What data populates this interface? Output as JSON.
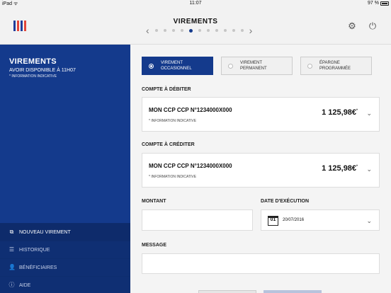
{
  "status": {
    "left": "iPad ᯤ",
    "time": "11:07",
    "battery": "97 %"
  },
  "header": {
    "title": "VIREMENTS"
  },
  "logo_colors": [
    "#1f3d9a",
    "#e2463a",
    "#1f3d9a",
    "#e2463a"
  ],
  "pager": {
    "dots": 11,
    "active_index": 4
  },
  "sidebar": {
    "title": "VIREMENTS",
    "subtitle": "AVOIR DISPONIBLE À 11H07",
    "note": "* INFORMATION INDICATIVE",
    "menu": [
      {
        "label": "NOUVEAU VIREMENT",
        "icon": "new-transfer-icon",
        "glyph": "⧉"
      },
      {
        "label": "HISTORIQUE",
        "icon": "history-list-icon",
        "glyph": "☰"
      },
      {
        "label": "BÉNÉFICIAIRES",
        "icon": "beneficiaries-icon",
        "glyph": "👤"
      },
      {
        "label": "AIDE",
        "icon": "help-icon",
        "glyph": "ⓘ"
      }
    ]
  },
  "segments": [
    {
      "label": "VIREMENT OCCASIONNEL",
      "line1": "VIREMENT",
      "line2": "OCCASIONNEL",
      "selected": true
    },
    {
      "label": "VIREMENT PERMANENT",
      "line1": "VIREMENT",
      "line2": "PERMANENT",
      "selected": false
    },
    {
      "label": "ÉPARGNE PROGRAMMÉE",
      "line1": "ÉPARGNE",
      "line2": "PROGRAMMÉE",
      "selected": false
    }
  ],
  "debit": {
    "label": "COMPTE À DÉBITER",
    "account": "MON CCP CCP N°1234000X000",
    "note": "* INFORMATION INDICATIVE",
    "amount": "1 125,98€",
    "amount_suffix": "*"
  },
  "credit": {
    "label": "COMPTE À CRÉDITER",
    "account": "MON CCP CCP N°1234000X000",
    "note": "* INFORMATION INDICATIVE",
    "amount": "1 125,98€",
    "amount_suffix": "*"
  },
  "montant": {
    "label": "MONTANT",
    "value": ""
  },
  "execution": {
    "label": "DATE D'EXÉCUTION",
    "calendar_day": "01",
    "value": "20/07/2016"
  },
  "message": {
    "label": "MESSAGE",
    "value": ""
  },
  "colors": {
    "primary": "#143a8c",
    "menu_bg": "#0f2f73"
  }
}
